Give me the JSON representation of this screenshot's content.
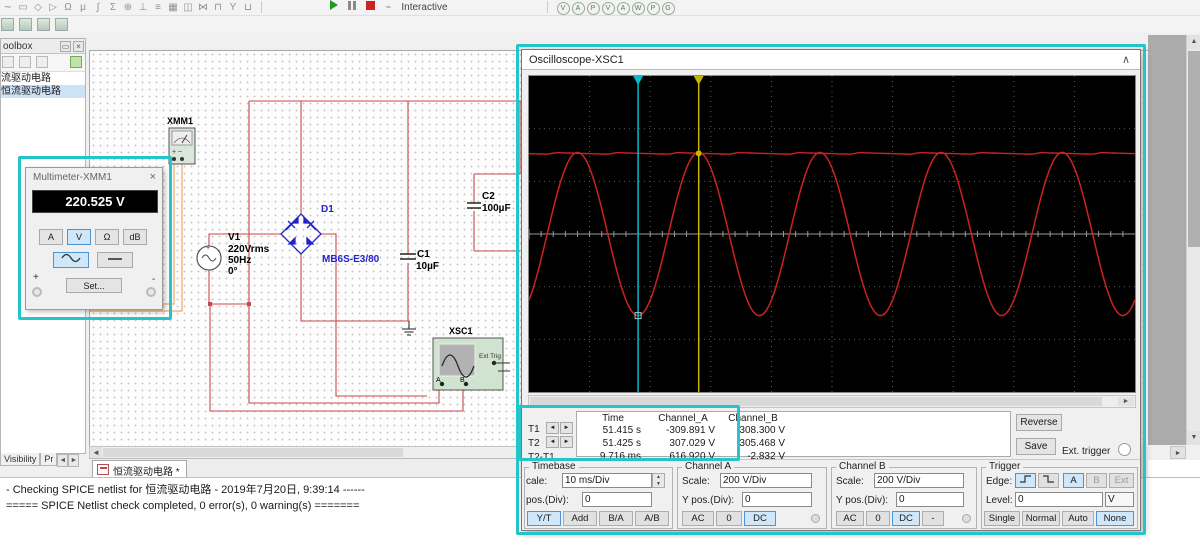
{
  "toolbar": {
    "icon_glyphs": [
      "∼",
      "▭",
      "◇",
      "▷",
      "Ω",
      "μ",
      "∫",
      "Σ",
      "⊕",
      "⊥",
      "≡",
      "▦",
      "◫",
      "⋈",
      "⊓",
      "Y",
      "⊔"
    ],
    "sim": {
      "profile_label": "Interactive"
    },
    "probe_letters": [
      "V",
      "A",
      "P",
      "V",
      "A",
      "W",
      "P",
      "G"
    ]
  },
  "toolbox": {
    "title": "oolbox",
    "min_glyph": "▭",
    "close_glyph": "×",
    "items": [
      {
        "label": "流驱动电路"
      },
      {
        "label": "恒流驱动电路"
      }
    ]
  },
  "bottom_tabs": {
    "visibility": "Visibility",
    "properties": "Pr"
  },
  "doc_tab": {
    "label": "恒流驱动电路 *"
  },
  "glyphs": {
    "left": "◄",
    "right": "►",
    "up": "▲",
    "down": "▼",
    "sb_up": "▲",
    "sb_down": "▼",
    "sb_right": "►",
    "sb_left": "◄",
    "collapse": "∧"
  },
  "multimeter": {
    "title": "Multimeter-XMM1",
    "close": "×",
    "reading": "220.525 V",
    "btn_a": "A",
    "btn_v": "V",
    "btn_ohm": "Ω",
    "btn_db": "dB",
    "plus": "+",
    "minus": "-",
    "set": "Set..."
  },
  "circuit": {
    "xmm1_label": "XMM1",
    "xsc1_label": "XSC1",
    "ext_trig": "Ext Trig",
    "term_a": "A",
    "term_b": "B",
    "v1": {
      "ref": "V1",
      "l1": "220Vrms",
      "l2": "50Hz",
      "l3": "0°"
    },
    "d1": {
      "ref": "D1",
      "part": "MB6S-E3/80"
    },
    "c1": {
      "ref": "C1",
      "val": "10µF"
    },
    "c2": {
      "ref": "C2",
      "val": "100µF"
    }
  },
  "oscilloscope": {
    "title": "Oscilloscope-XSC1",
    "meas": {
      "h_time": "Time",
      "h_a": "Channel_A",
      "h_b": "Channel_B",
      "t1": "T1",
      "t2": "T2",
      "dt": "T2-T1",
      "r1": {
        "time": "51.415 s",
        "a": "-309.891 V",
        "b": "308.300 V"
      },
      "r2": {
        "time": "51.425 s",
        "a": "307.029 V",
        "b": "305.468 V"
      },
      "r3": {
        "time": "9.716 ms",
        "a": "616.920 V",
        "b": "-2.832 V"
      },
      "reverse": "Reverse",
      "save": "Save",
      "ext": "Ext. trigger"
    },
    "timebase": {
      "title": "Timebase",
      "scale_label": "cale:",
      "scale": "10 ms/Div",
      "pos_label": "pos.(Div):",
      "pos": "0",
      "b1": "Y/T",
      "b2": "Add",
      "b3": "B/A",
      "b4": "A/B"
    },
    "cha": {
      "title": "Channel A",
      "scale_label": "Scale:",
      "scale": "200 V/Div",
      "pos_label": "Y pos.(Div):",
      "pos": "0",
      "b1": "AC",
      "b2": "0",
      "b3": "DC"
    },
    "chb": {
      "title": "Channel B",
      "scale_label": "Scale:",
      "scale": "200 V/Div",
      "pos_label": "Y pos.(Div):",
      "pos": "0",
      "b1": "AC",
      "b2": "0",
      "b3": "DC",
      "b4": "-"
    },
    "trig": {
      "title": "Trigger",
      "edge_label": "Edge:",
      "a": "A",
      "b": "B",
      "ext": "Ext",
      "level_label": "Level:",
      "level": "0",
      "unit": "V",
      "m1": "Single",
      "m2": "Normal",
      "m3": "Auto",
      "m4": "None"
    }
  },
  "output": {
    "line1": "- Checking SPICE netlist for 恒流驱动电路 - 2019年7月20日, 9:39:14 ------",
    "line2": "===== SPICE Netlist check completed, 0 error(s), 0 warning(s) ======="
  },
  "chart_data": {
    "type": "line",
    "title": "Oscilloscope-XSC1 display",
    "divisions_x": 10,
    "divisions_y": 6,
    "timebase_ms_per_div": 10,
    "volts_per_div": 200,
    "t_range_s": [
      51.397,
      51.497
    ],
    "grid": "dotted",
    "series": [
      {
        "name": "Channel_A",
        "waveform": "sine",
        "frequency_hz": 50,
        "amplitude_v": 310,
        "offset_v": 0,
        "color": "#cc2222"
      },
      {
        "name": "Channel_B",
        "waveform": "dc_ripple",
        "mean_v": 306,
        "ripple_v": 6,
        "ripple_hz": 100,
        "color": "#cc2222"
      }
    ],
    "cursors": [
      {
        "name": "T1",
        "time_s": 51.415,
        "color": "#00bcd0"
      },
      {
        "name": "T2",
        "time_s": 51.425,
        "color": "#c9b400"
      }
    ]
  }
}
